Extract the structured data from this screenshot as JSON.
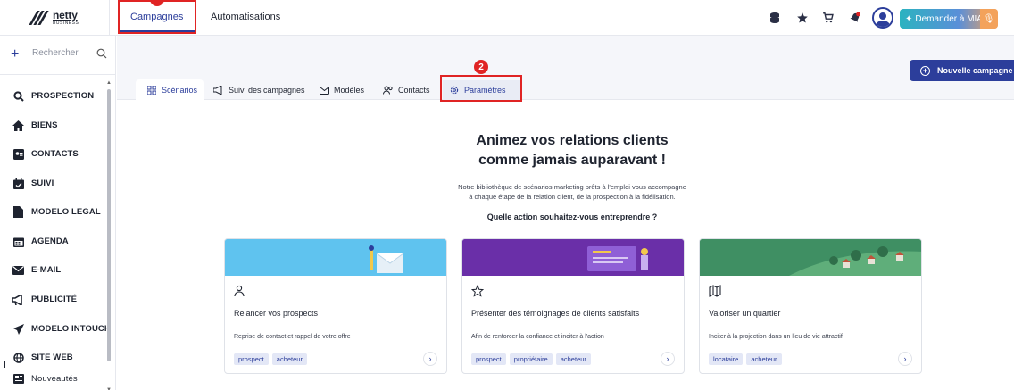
{
  "header": {
    "logo_text": "netty",
    "logo_subtext": "BUSINESS",
    "tabs": [
      {
        "label": "Campagnes",
        "active": true
      },
      {
        "label": "Automatisations",
        "active": false
      }
    ],
    "mia_label": "Demander à MIA"
  },
  "sidebar": {
    "search_placeholder": "Rechercher",
    "items": [
      {
        "label": "PROSPECTION",
        "icon": "search-icon"
      },
      {
        "label": "BIENS",
        "icon": "home-icon"
      },
      {
        "label": "CONTACTS",
        "icon": "contact-card-icon"
      },
      {
        "label": "SUIVI",
        "icon": "calendar-check-icon"
      },
      {
        "label": "MODELO LEGAL",
        "icon": "document-icon"
      },
      {
        "label": "AGENDA",
        "icon": "calendar-icon"
      },
      {
        "label": "E-MAIL",
        "icon": "mail-icon"
      },
      {
        "label": "PUBLICITÉ",
        "icon": "megaphone-icon"
      },
      {
        "label": "MODELO INTOUCH",
        "icon": "send-icon"
      },
      {
        "label": "SITE WEB",
        "icon": "globe-icon"
      },
      {
        "label": "Nouveautés",
        "icon": "news-icon"
      }
    ]
  },
  "subtabs": [
    {
      "label": "Scénarios",
      "icon": "grid-icon",
      "active": true
    },
    {
      "label": "Suivi des campagnes",
      "icon": "megaphone-icon",
      "active": false
    },
    {
      "label": "Modèles",
      "icon": "mail-icon",
      "active": false
    },
    {
      "label": "Contacts",
      "icon": "users-icon",
      "active": false
    },
    {
      "label": "Paramètres",
      "icon": "gear-icon",
      "active": false
    }
  ],
  "annotation_badge": "2",
  "new_campaign_label": "Nouvelle campagne",
  "hero": {
    "title_line1": "Animez vos relations clients",
    "title_line2": "comme jamais auparavant !",
    "desc_line1": "Notre bibliothèque de scénarios marketing prêts à l'emploi vous accompagne",
    "desc_line2": "à chaque étape de la relation client, de la prospection à la fidélisation.",
    "question": "Quelle action souhaitez-vous entreprendre ?"
  },
  "cards": [
    {
      "icon": "user-icon",
      "title": "Relancer vos prospects",
      "desc": "Reprise de contact et rappel de votre offre",
      "tags": [
        "prospect",
        "acheteur"
      ],
      "banner_color": "#5fc3ef"
    },
    {
      "icon": "star-icon",
      "title": "Présenter des témoignages de clients satisfaits",
      "desc": "Afin de renforcer la confiance et inciter à l'action",
      "tags": [
        "prospect",
        "propriétaire",
        "acheteur"
      ],
      "banner_color": "#6a2fa8"
    },
    {
      "icon": "map-icon",
      "title": "Valoriser un quartier",
      "desc": "Inciter à la projection dans un lieu de vie attractif",
      "tags": [
        "locataire",
        "acheteur"
      ],
      "banner_color": "#3f8f63"
    }
  ],
  "colors": {
    "accent": "#2c3e9b",
    "annotation": "#e02424"
  }
}
